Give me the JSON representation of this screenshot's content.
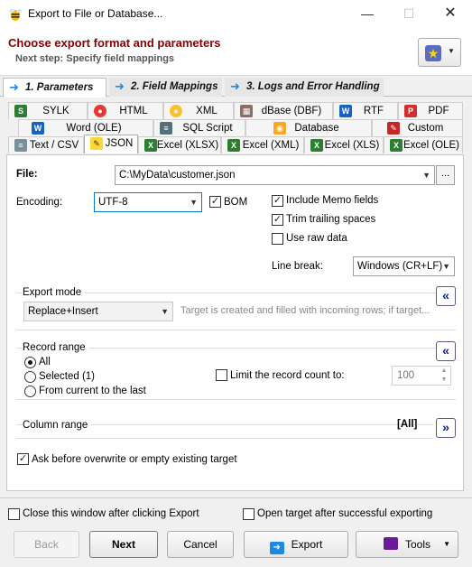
{
  "window": {
    "title": "Export to File or Database..."
  },
  "header": {
    "title": "Choose export format and parameters",
    "subtitle": "Next step: Specify field mappings"
  },
  "steps": [
    {
      "label": "1. Parameters"
    },
    {
      "label": "2. Field Mappings"
    },
    {
      "label": "3. Logs and Error Handling"
    }
  ],
  "formats": {
    "row1": [
      "SYLK",
      "HTML",
      "XML",
      "dBase (DBF)",
      "RTF",
      "PDF"
    ],
    "row2": [
      "Word (OLE)",
      "SQL Script",
      "Database",
      "Custom"
    ],
    "row3": [
      "Text / CSV",
      "JSON",
      "Excel (XLSX)",
      "Excel (XML)",
      "Excel (XLS)",
      "Excel (OLE)"
    ],
    "selected": "JSON"
  },
  "file": {
    "label": "File:",
    "value": "C:\\MyData\\customer.json",
    "browse": "..."
  },
  "encoding": {
    "label": "Encoding:",
    "value": "UTF-8",
    "bom_label": "BOM",
    "bom_checked": true
  },
  "options": {
    "include_memo": "Include Memo fields",
    "trim_trailing": "Trim trailing spaces",
    "use_raw": "Use raw data",
    "include_memo_checked": true,
    "trim_trailing_checked": true,
    "use_raw_checked": false
  },
  "line_break": {
    "label": "Line break:",
    "value": "Windows (CR+LF)"
  },
  "export_mode": {
    "title": "Export mode",
    "value": "Replace+Insert",
    "description": "Target is created and filled with incoming rows; if target..."
  },
  "record_range": {
    "title": "Record range",
    "all": "All",
    "selected": "Selected (1)",
    "from_current": "From current to the last",
    "limit_label": "Limit the record count to:",
    "limit_value": "100",
    "limit_checked": false
  },
  "column_range": {
    "title": "Column range",
    "value": "[All]"
  },
  "ask_overwrite": {
    "label": "Ask before overwrite or empty existing target",
    "checked": true
  },
  "footer": {
    "close_after": "Close this window after clicking Export",
    "open_target": "Open target after successful exporting",
    "close_after_checked": false,
    "open_target_checked": false
  },
  "buttons": {
    "back": "Back",
    "next": "Next",
    "cancel": "Cancel",
    "export": "Export",
    "tools": "Tools"
  },
  "colors": {
    "header_title": "#8b0000",
    "accent": "#1e88e5",
    "collapse": "#0a1f8f"
  }
}
